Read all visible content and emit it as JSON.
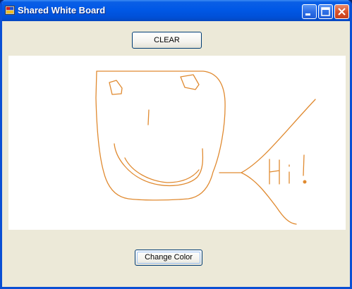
{
  "window": {
    "title": "Shared White Board",
    "controls": [
      "minimize",
      "maximize",
      "close"
    ]
  },
  "toolbar": {
    "clear_label": "CLEAR"
  },
  "board": {
    "drawing_color": "#e08a30",
    "drawing_description": "freehand smiley face with speech bubble",
    "drawn_text": "Hi!"
  },
  "footer": {
    "change_color_label": "Change Color"
  },
  "colors": {
    "titlebar": "#0058e6",
    "window_bg": "#ece9d8",
    "canvas_bg": "#ffffff",
    "stroke": "#e08a30"
  }
}
